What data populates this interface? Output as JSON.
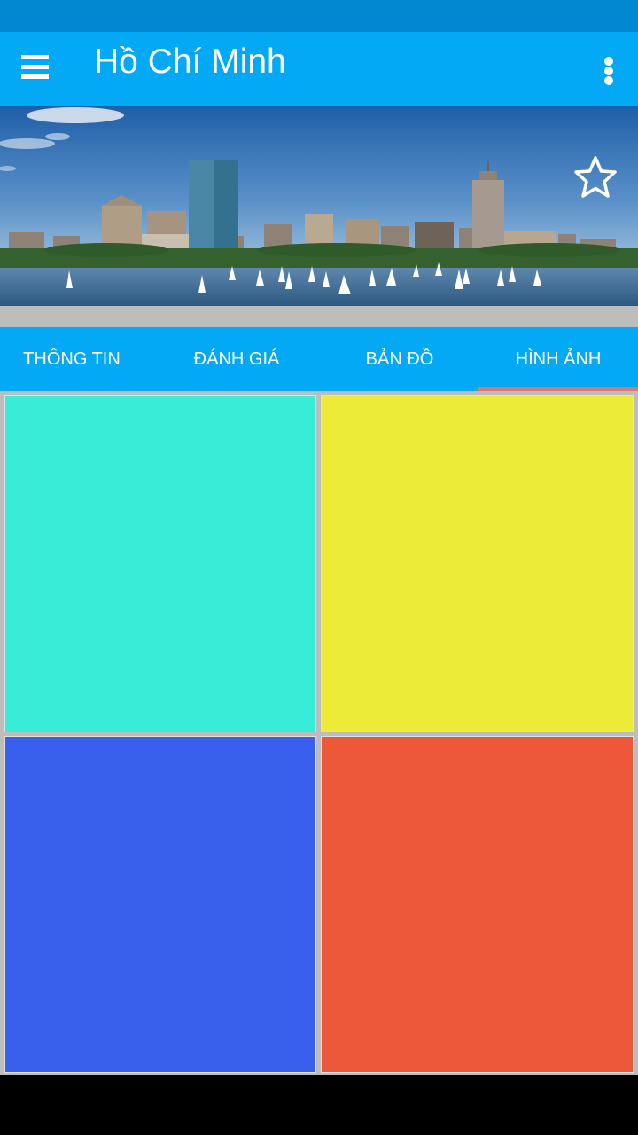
{
  "colors": {
    "status_bar": "#0288d1",
    "primary": "#03a9f4",
    "tab_indicator": "#e57373",
    "grid_background": "#bdbdbd"
  },
  "app_bar": {
    "title": "Hồ Chí Minh",
    "menu_icon": "hamburger-menu-icon",
    "overflow_icon": "more-vert-icon"
  },
  "hero": {
    "image": "city-skyline-waterfront",
    "favorite_icon": "star-outline-icon"
  },
  "tabs": [
    {
      "label": "THÔNG TIN"
    },
    {
      "label": "ĐÁNH GIÁ"
    },
    {
      "label": "BẢN ĐỒ"
    },
    {
      "label": "HÌNH ẢNH",
      "selected": true
    }
  ],
  "gallery": [
    {
      "color": "#38ecd8"
    },
    {
      "color": "#ecec38"
    },
    {
      "color": "#3860ec"
    },
    {
      "color": "#ec5838"
    }
  ]
}
